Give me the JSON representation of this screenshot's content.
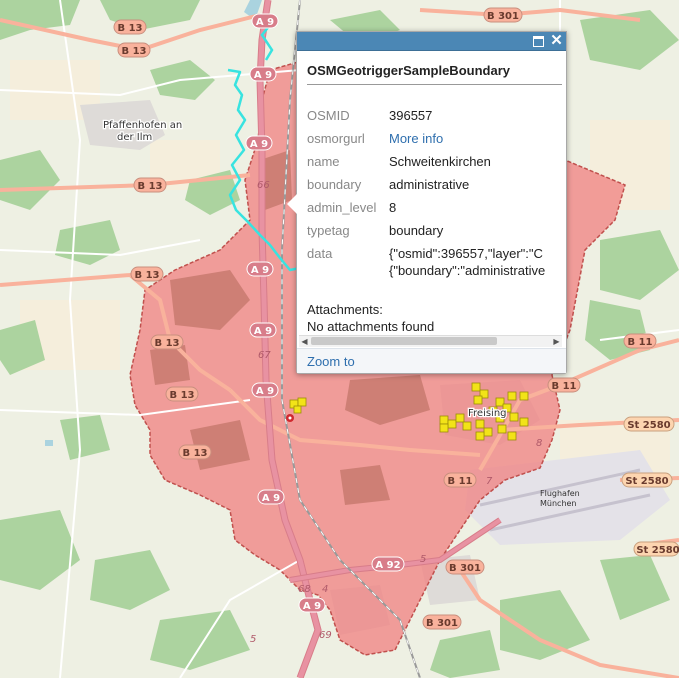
{
  "popup": {
    "title": "OSMGeotriggerSampleBoundary",
    "fields": [
      {
        "key": "OSMID",
        "value": "396557"
      },
      {
        "key": "osmorgurl",
        "value": "More info"
      },
      {
        "key": "name",
        "value": "Schweitenkirchen"
      },
      {
        "key": "boundary",
        "value": "administrative"
      },
      {
        "key": "admin_level",
        "value": "8"
      },
      {
        "key": "typetag",
        "value": "boundary"
      },
      {
        "key": "data",
        "value": "{\"osmid\":396557,\"layer\":\"C",
        "value2": "{\"boundary\":\"administrative"
      }
    ],
    "attachments_label": "Attachments:",
    "attachments_value": "No attachments found",
    "zoom_label": "Zoom to"
  },
  "map": {
    "colors": {
      "boundary_fill": "#f08080",
      "boundary_stroke": "#c0504d",
      "cyan_border": "#38e3e0",
      "motorway": "#e892a2",
      "trunk": "#f9b29c",
      "forest": "#a7d19a",
      "marker": "#f2e318"
    },
    "town_labels": {
      "pfaffenhofen_1": "Pfaffenhofen an",
      "pfaffenhofen_2": "der Ilm",
      "freising": "Freising",
      "flughafen_1": "Flughafen",
      "flughafen_2": "München"
    },
    "badges": {
      "a9_1": "A 9",
      "a9_2": "A 9",
      "a9_3": "A 9",
      "a9_4": "A 9",
      "a9_5": "A 9",
      "a9_6": "A 9",
      "a9_7": "A 9",
      "a9_8": "A 9",
      "a92": "A 92",
      "b13_1": "B 13",
      "b13_2": "B 13",
      "b13_3": "B 13",
      "b13_4": "B 13",
      "b13_5": "B 13",
      "b13_6": "B 13",
      "b13_7": "B 13",
      "b11_1": "B 11",
      "b11_2": "B 11",
      "b11_3": "B 11",
      "b301_1": "B 301",
      "b301_2": "B 301",
      "b301_3": "B 301",
      "st2580_1": "St 2580",
      "st2580_2": "St 2580",
      "st2580_3": "St 2580"
    },
    "route_numbers": {
      "r66": "66",
      "r67": "67",
      "r68": "68",
      "r69": "69",
      "r7": "7",
      "r8": "8",
      "r5": "5",
      "r4": "4"
    }
  }
}
